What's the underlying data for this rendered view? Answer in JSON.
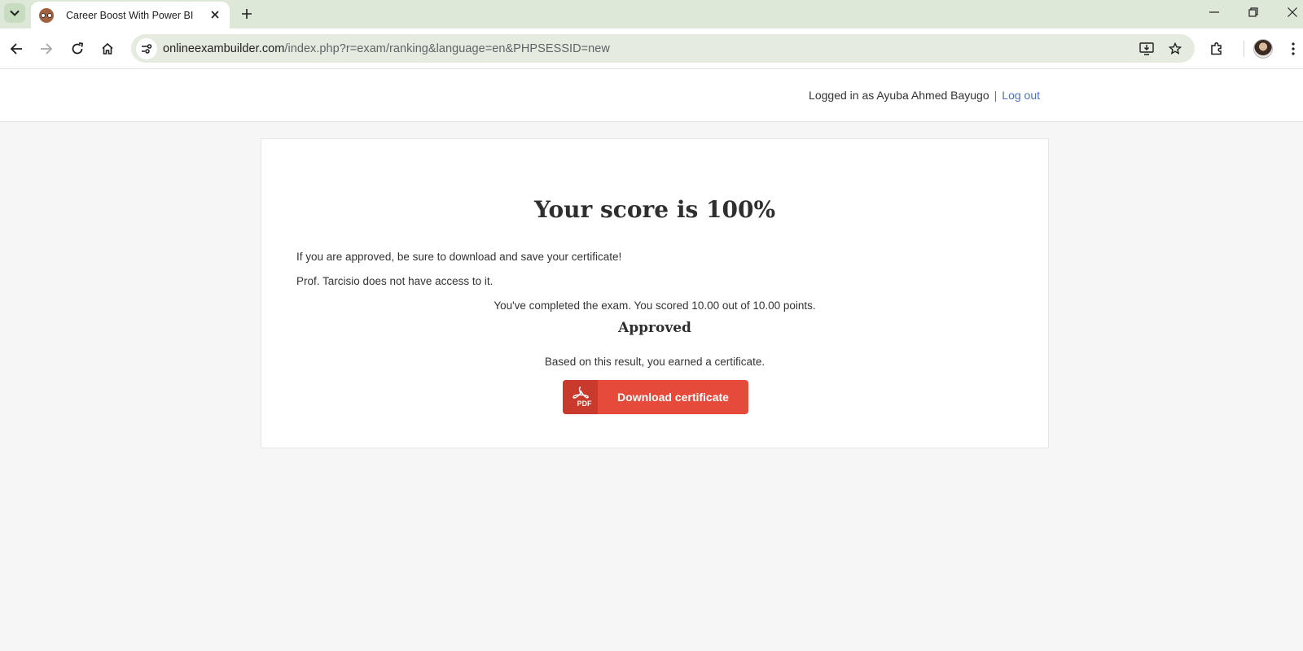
{
  "browser": {
    "tab_title": "Career Boost With Power BI",
    "url_host": "onlineexambuilder.com",
    "url_path": "/index.php?r=exam/ranking&language=en&PHPSESSID=new",
    "icons": [
      "tab-search-icon",
      "tab-favicon-icon",
      "tab-close-icon",
      "new-tab-icon",
      "minimize-icon",
      "restore-icon",
      "close-window-icon",
      "back-icon",
      "forward-icon",
      "reload-icon",
      "home-icon",
      "site-info-icon",
      "install-app-icon",
      "star-icon",
      "extensions-icon",
      "profile-avatar",
      "menu-icon"
    ]
  },
  "header": {
    "logged_in_text": "Logged in as Ayuba Ahmed Bayugo",
    "separator": "|",
    "logout_label": "Log out"
  },
  "result": {
    "score_heading": "Your score is 100%",
    "advice_line_1": "If you are approved, be sure to download and save your certificate!",
    "advice_line_2": "Prof. Tarcisio does not have access to it.",
    "completion_text": "You've completed the exam. You scored 10.00 out of 10.00 points.",
    "status": "Approved",
    "certificate_text": "Based on this result, you earned a certificate.",
    "download_label": "Download certificate",
    "pdf_badge": "PDF"
  },
  "colors": {
    "accent_red": "#e64a3b",
    "accent_red_dark": "#c93a2d",
    "link_blue": "#4a6fc4",
    "chrome_green": "#dde8d8"
  }
}
